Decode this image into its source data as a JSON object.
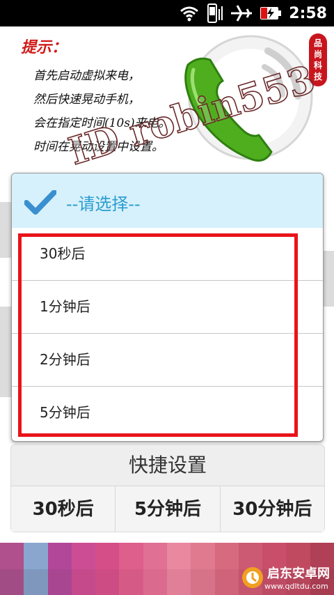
{
  "status_bar": {
    "time": "2:58"
  },
  "hint": {
    "title": "提示：",
    "lines": [
      "首先启动虚拟来电，",
      "然后快速晃动手机，",
      "会在指定时间(10s)来电。",
      "时间在晃动设置中设置。"
    ]
  },
  "badge": {
    "lines": [
      "品",
      "尚",
      "科",
      "技"
    ]
  },
  "watermark": {
    "text": "ID robin553"
  },
  "dialog": {
    "title": "--请选择--",
    "options": [
      "30秒后",
      "1分钟后",
      "2分钟后",
      "5分钟后"
    ]
  },
  "quick_settings": {
    "title": "快捷设置",
    "buttons": [
      "30秒后",
      "5分钟后",
      "30分钟后"
    ]
  },
  "site": {
    "name": "启东安卓网",
    "url": "www.qdltdu.com"
  },
  "colors": {
    "accent": "#2a9ccf",
    "highlight": "#e8141a",
    "header_bg": "#d6f1fb"
  }
}
